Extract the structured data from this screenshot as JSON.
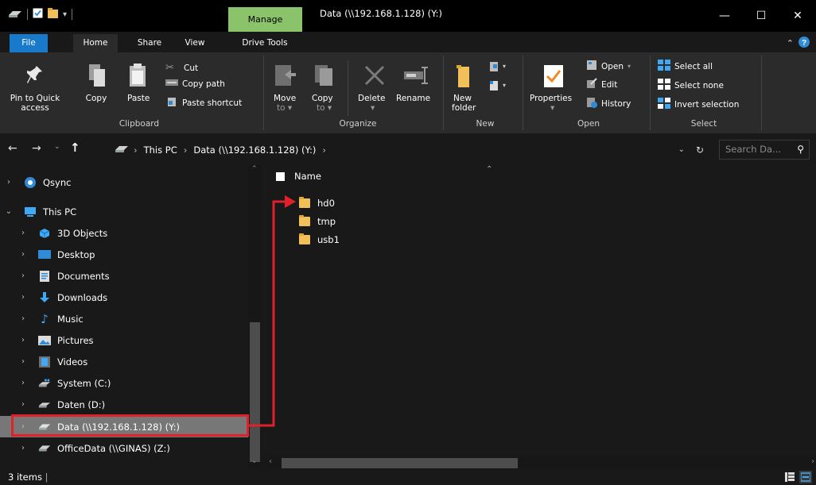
{
  "titlebar": {
    "context_tab": "Manage",
    "title": "Data (\\\\192.168.1.128) (Y:)",
    "minimize": "—",
    "maximize": "☐",
    "close": "✕"
  },
  "tabs": {
    "file": "File",
    "home": "Home",
    "share": "Share",
    "view": "View",
    "drive_tools": "Drive Tools"
  },
  "ribbon": {
    "clipboard": {
      "pin_line1": "Pin to Quick",
      "pin_line2": "access",
      "copy": "Copy",
      "paste": "Paste",
      "cut": "Cut",
      "copy_path": "Copy path",
      "paste_shortcut": "Paste shortcut",
      "group": "Clipboard"
    },
    "organize": {
      "move_line1": "Move",
      "move_line2": "to",
      "copy_line1": "Copy",
      "copy_line2": "to",
      "delete": "Delete",
      "rename": "Rename",
      "group": "Organize"
    },
    "new": {
      "new_folder_line1": "New",
      "new_folder_line2": "folder",
      "group": "New"
    },
    "open": {
      "properties": "Properties",
      "open": "Open",
      "edit": "Edit",
      "history": "History",
      "group": "Open"
    },
    "select": {
      "select_all": "Select all",
      "select_none": "Select none",
      "invert_selection": "Invert selection",
      "group": "Select"
    }
  },
  "address": {
    "crumbs": [
      "This PC",
      "Data (\\\\192.168.1.128) (Y:)"
    ],
    "search_placeholder": "Search Da..."
  },
  "nav": {
    "items": [
      {
        "label": "Qsync",
        "icon": "qsync-icon"
      },
      {
        "label": "This PC",
        "icon": "this-pc-icon"
      },
      {
        "label": "3D Objects",
        "icon": "3d-objects-icon"
      },
      {
        "label": "Desktop",
        "icon": "desktop-icon"
      },
      {
        "label": "Documents",
        "icon": "documents-icon"
      },
      {
        "label": "Downloads",
        "icon": "downloads-icon"
      },
      {
        "label": "Music",
        "icon": "music-icon"
      },
      {
        "label": "Pictures",
        "icon": "pictures-icon"
      },
      {
        "label": "Videos",
        "icon": "videos-icon"
      },
      {
        "label": "System (C:)",
        "icon": "system-drive-icon"
      },
      {
        "label": "Daten (D:)",
        "icon": "drive-icon"
      },
      {
        "label": "Data (\\\\192.168.1.128) (Y:)",
        "icon": "network-drive-icon"
      },
      {
        "label": "OfficeData (\\\\GINAS) (Z:)",
        "icon": "network-drive-icon"
      }
    ]
  },
  "files": {
    "column_name": "Name",
    "items": [
      "hd0",
      "tmp",
      "usb1"
    ]
  },
  "status": {
    "count": "3 items"
  },
  "colors": {
    "background": "#191919",
    "ribbon": "#2b2b2b",
    "file_tab": "#1979ca",
    "manage_tab": "#8bc36a",
    "selection": "#777777",
    "annotation": "#e0202a",
    "folder": "#f2c05a"
  }
}
